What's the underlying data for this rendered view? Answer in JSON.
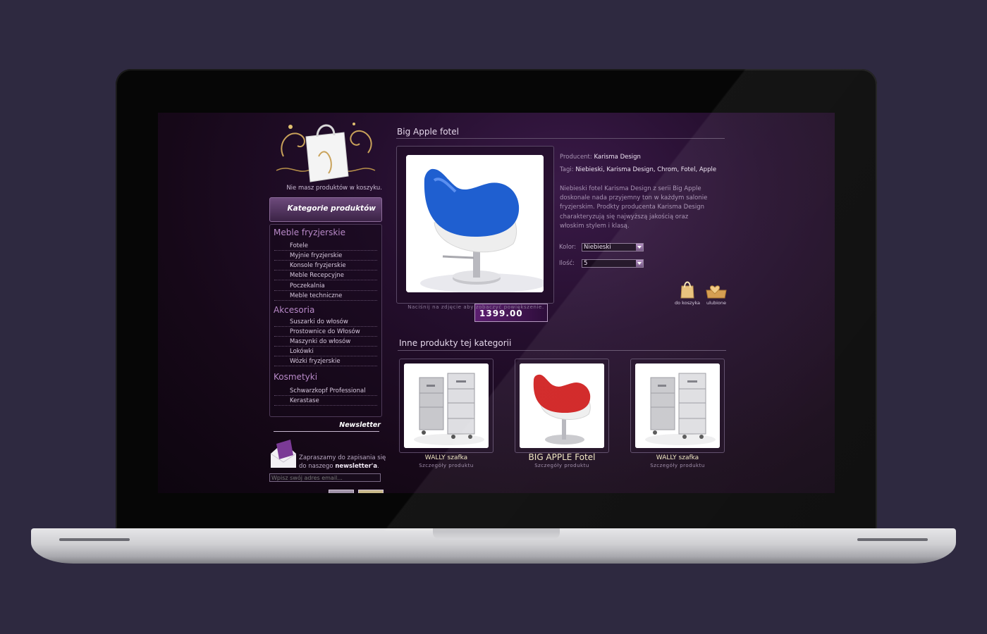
{
  "sidebar": {
    "cart_empty": "Nie masz produktów w koszyku.",
    "categories_header": "Kategorie produktów",
    "groups": [
      {
        "title": "Meble fryzjerskie",
        "items": [
          "Fotele",
          "Myjnie fryzjerskie",
          "Konsole fryzjerskie",
          "Meble Recepcyjne",
          "Poczekalnia",
          "Meble techniczne"
        ]
      },
      {
        "title": "Akcesoria",
        "items": [
          "Suszarki do włosów",
          "Prostownice do Włosów",
          "Maszynki do włosów",
          "Lokówki",
          "Wózki fryzjerskie"
        ]
      },
      {
        "title": "Kosmetyki",
        "items": [
          "Schwarzkopf Professional",
          "Kerastase"
        ]
      }
    ],
    "newsletter": {
      "title": "Newsletter",
      "text_before": "Zapraszamy do zapisania się do naszego ",
      "text_bold": "newsletter'a",
      "text_after": ".",
      "placeholder": "Wpisz swój adres email..."
    }
  },
  "product": {
    "title": "Big Apple fotel",
    "price": "1399.00",
    "image_caption": "Naciśnij na zdjęcie aby zobaczyć powiększenie.",
    "producer_label": "Producent:",
    "producer": "Karisma Design",
    "tags_label": "Tagi:",
    "tags": "Niebieski, Karisma Design, Chrom, Fotel, Apple",
    "description": "Niebieski fotel Karisma Design z serii Big Apple doskonale nada przyjemny ton w każdym salonie fryzjerskim. Prodkty producenta Karisma Design charakteryzują się najwyższą jakością oraz włoskim stylem i klasą.",
    "color_label": "Kolor:",
    "color_value": "Niebieski",
    "qty_label": "Ilość:",
    "qty_value": "5",
    "add_to_cart": "do koszyka",
    "favorites": "ulubione"
  },
  "related": {
    "title": "Inne produkty tej kategorii",
    "items": [
      {
        "name": "WALLY szafka",
        "sub": "Szczegóły produktu"
      },
      {
        "name": "BIG APPLE Fotel",
        "sub": "Szczegóły produktu"
      },
      {
        "name": "WALLY szafka",
        "sub": "Szczegóły produktu"
      }
    ]
  },
  "colors": {
    "page_bg": "#2e2940",
    "accent_purple": "#b889c8",
    "chair_blue": "#1f5fd0",
    "chair_red": "#d02020"
  }
}
